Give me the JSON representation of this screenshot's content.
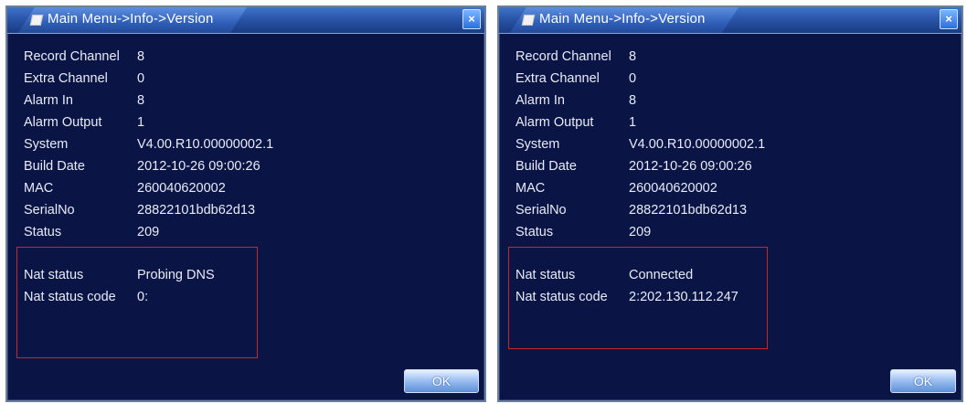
{
  "dialogs": [
    {
      "title": "Main Menu->Info->Version",
      "close_label": "×",
      "info": [
        {
          "label": "Record Channel",
          "value": "8"
        },
        {
          "label": "Extra Channel",
          "value": "0"
        },
        {
          "label": "Alarm In",
          "value": "8"
        },
        {
          "label": "Alarm Output",
          "value": "1"
        },
        {
          "label": "System",
          "value": "V4.00.R10.00000002.1"
        },
        {
          "label": "Build Date",
          "value": "2012-10-26 09:00:26"
        },
        {
          "label": "MAC",
          "value": "260040620002"
        },
        {
          "label": "SerialNo",
          "value": "28822101bdb62d13"
        },
        {
          "label": "Status",
          "value": "209"
        }
      ],
      "nat": [
        {
          "label": "Nat status",
          "value": "Probing DNS"
        },
        {
          "label": "Nat status code",
          "value": "0:"
        }
      ],
      "ok_label": "OK"
    },
    {
      "title": "Main Menu->Info->Version",
      "close_label": "×",
      "info": [
        {
          "label": "Record Channel",
          "value": "8"
        },
        {
          "label": "Extra Channel",
          "value": "0"
        },
        {
          "label": "Alarm In",
          "value": "8"
        },
        {
          "label": "Alarm Output",
          "value": "1"
        },
        {
          "label": "System",
          "value": "V4.00.R10.00000002.1"
        },
        {
          "label": "Build Date",
          "value": "2012-10-26 09:00:26"
        },
        {
          "label": "MAC",
          "value": "260040620002"
        },
        {
          "label": "SerialNo",
          "value": "28822101bdb62d13"
        },
        {
          "label": "Status",
          "value": "209"
        }
      ],
      "nat": [
        {
          "label": "Nat status",
          "value": "Connected"
        },
        {
          "label": "Nat status code",
          "value": "2:202.130.112.247"
        }
      ],
      "ok_label": "OK"
    }
  ],
  "colors": {
    "panel_background": "#0a1445",
    "title_bar": "#2a55a8",
    "text": "#e8ecf6",
    "highlight_box": "#c2282c"
  }
}
